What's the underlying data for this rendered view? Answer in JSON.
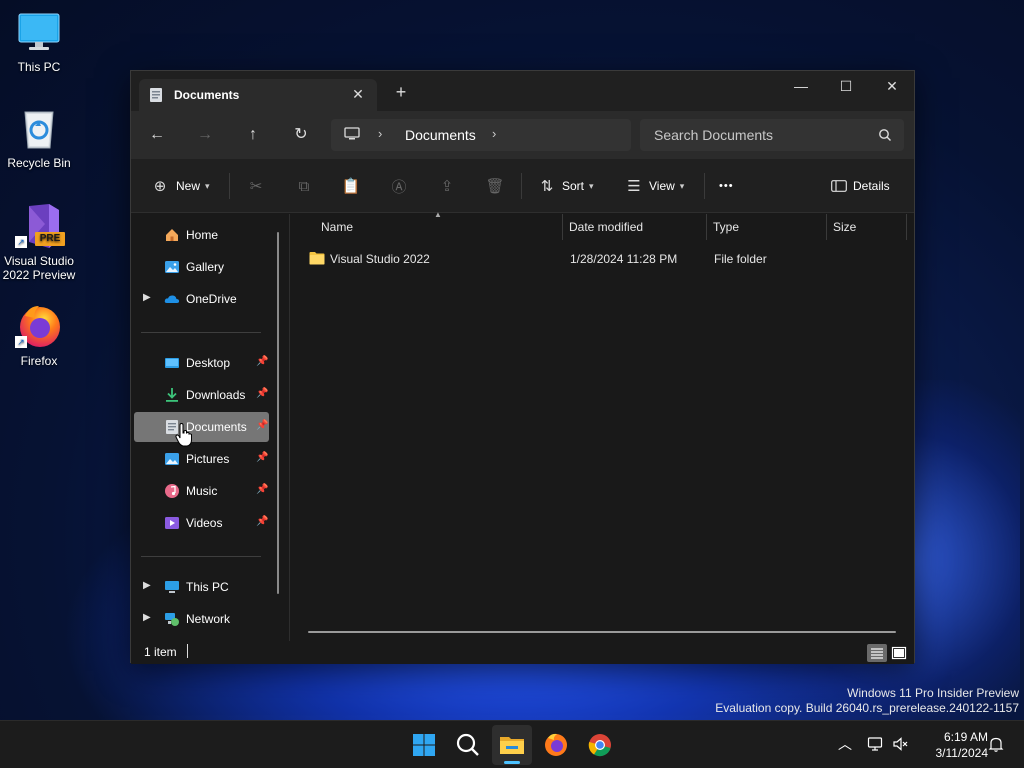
{
  "desktop": {
    "icons": [
      {
        "label": "This PC"
      },
      {
        "label": "Recycle Bin"
      },
      {
        "label": "Visual Studio 2022 Preview",
        "badge": "PRE"
      },
      {
        "label": "Firefox"
      }
    ]
  },
  "window": {
    "tab_title": "Documents",
    "tab_close": "✕",
    "new_tab": "+",
    "controls": {
      "minimize": "—",
      "maximize": "☐",
      "close": "✕"
    },
    "breadcrumb": {
      "chevron": "›",
      "current": "Documents"
    },
    "search_placeholder": "Search Documents",
    "toolbar": {
      "new_label": "New",
      "sort_label": "Sort",
      "view_label": "View",
      "more_label": "•••",
      "details_label": "Details"
    },
    "sidebar": {
      "home": "Home",
      "gallery": "Gallery",
      "onedrive": "OneDrive",
      "desktop": "Desktop",
      "downloads": "Downloads",
      "documents": "Documents",
      "pictures": "Pictures",
      "music": "Music",
      "videos": "Videos",
      "this_pc": "This PC",
      "network": "Network"
    },
    "columns": {
      "name": "Name",
      "date_modified": "Date modified",
      "type": "Type",
      "size": "Size"
    },
    "files": [
      {
        "name": "Visual Studio 2022",
        "date_modified": "1/28/2024 11:28 PM",
        "type": "File folder",
        "size": ""
      }
    ],
    "status": {
      "item_count": "1 item"
    }
  },
  "watermark": {
    "line1": "Windows 11 Pro Insider Preview",
    "line2": "Evaluation copy. Build 26040.rs_prerelease.240122-1157"
  },
  "taskbar": {
    "clock_time": "6:19 AM",
    "clock_date": "3/11/2024"
  },
  "colors": {
    "accent": "#4cc2ff",
    "folder": "#f5c542",
    "window_bg": "#191919",
    "selected_item": "#767676"
  }
}
